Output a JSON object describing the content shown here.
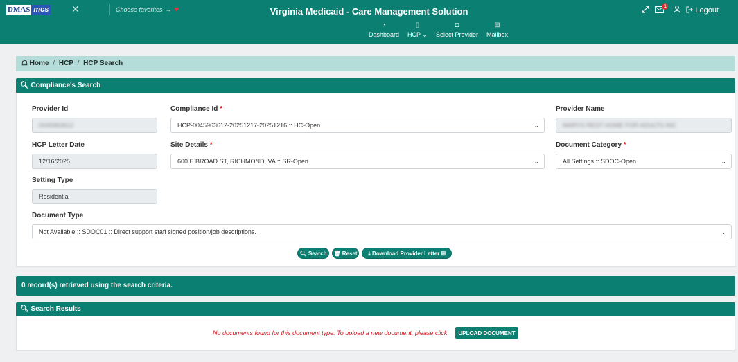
{
  "header": {
    "logo_left": "DMAS",
    "logo_right": "mcs",
    "favorites_label": "Choose favorites",
    "favorites_arrow": "→",
    "app_title": "Virginia Medicaid - Care Management Solution",
    "notification_count": "1",
    "logout_label": "Logout"
  },
  "nav": {
    "items": [
      {
        "label": "Dashboard",
        "icon": "dashboard-icon"
      },
      {
        "label": "HCP",
        "icon": "document-icon",
        "caret": "⌄"
      },
      {
        "label": "Select Provider",
        "icon": "briefcase-icon"
      },
      {
        "label": "Mailbox",
        "icon": "mailbox-icon"
      }
    ]
  },
  "breadcrumb": {
    "home": "Home",
    "hcp": "HCP",
    "current": "HCP Search",
    "sep": "/"
  },
  "search_panel": {
    "title": "Compliance's Search",
    "provider_id_label": "Provider Id",
    "provider_id_value": "0045963612",
    "compliance_id_label": "Compliance Id",
    "compliance_id_value": "HCP-0045963612-20251217-20251216 :: HC-Open",
    "provider_name_label": "Provider Name",
    "provider_name_value": "MARYS REST HOME FOR ADULTS INC",
    "letter_date_label": "HCP Letter Date",
    "letter_date_value": "12/16/2025",
    "site_details_label": "Site Details",
    "site_details_value": "600 E BROAD ST, RICHMOND, VA :: SR-Open",
    "doc_category_label": "Document Category",
    "doc_category_value": "All Settings :: SDOC-Open",
    "setting_type_label": "Setting Type",
    "setting_type_value": "Residential",
    "doc_type_label": "Document Type",
    "doc_type_value": "Not Available :: SDOC01 :: Direct support staff signed position/job descriptions.",
    "required_mark": "*",
    "search_btn": "Search",
    "reset_btn": "Reset",
    "download_btn": "Download Provider Letter"
  },
  "records_message": "0 record(s) retrieved using the search criteria.",
  "results_panel": {
    "title": "Search Results",
    "empty_message": "No documents found for this document type. To upload a new document, please click",
    "upload_btn": "UPLOAD DOCUMENT"
  },
  "colors": {
    "primary": "#0b7f72",
    "breadcrumb_bg": "#b4dcd9",
    "required": "#d0141c"
  }
}
